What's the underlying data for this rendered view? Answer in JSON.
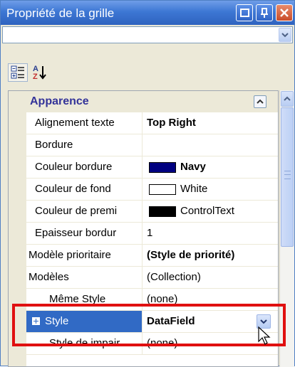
{
  "window": {
    "title": "Propriété de la grille",
    "object_selector_value": ""
  },
  "toolbar": {
    "categorized_icon": "categorized-icon",
    "alphabetical_icon": "sort-az-icon"
  },
  "category": {
    "label": "Apparence"
  },
  "rows": [
    {
      "name": "Alignement texte",
      "value": "Top Right",
      "bold": true
    },
    {
      "name": "Bordure",
      "value": ""
    },
    {
      "name": "Couleur bordure",
      "value": "Navy",
      "swatch": "#000080",
      "bold": true
    },
    {
      "name": "Couleur de fond",
      "value": "White",
      "swatch": "#ffffff"
    },
    {
      "name": "Couleur de premi",
      "value": "ControlText",
      "swatch": "#000000"
    },
    {
      "name": "Epaisseur bordur",
      "value": "1"
    },
    {
      "name": "Modèle prioritaire",
      "value": "(Style de priorité)",
      "expand": "plus",
      "bold": true
    },
    {
      "name": "Modèles",
      "value": "(Collection)",
      "expand": "minus"
    },
    {
      "name": "Même Style",
      "value": "(none)"
    },
    {
      "name": "Style",
      "value": "DataField",
      "selected": true,
      "bold": true
    },
    {
      "name": "Style de impair",
      "value": "(none)"
    }
  ],
  "colors": {
    "title_bar": "#3d77d4",
    "selection": "#316ac5",
    "category_text": "#333399",
    "highlight_box": "#e01010"
  }
}
